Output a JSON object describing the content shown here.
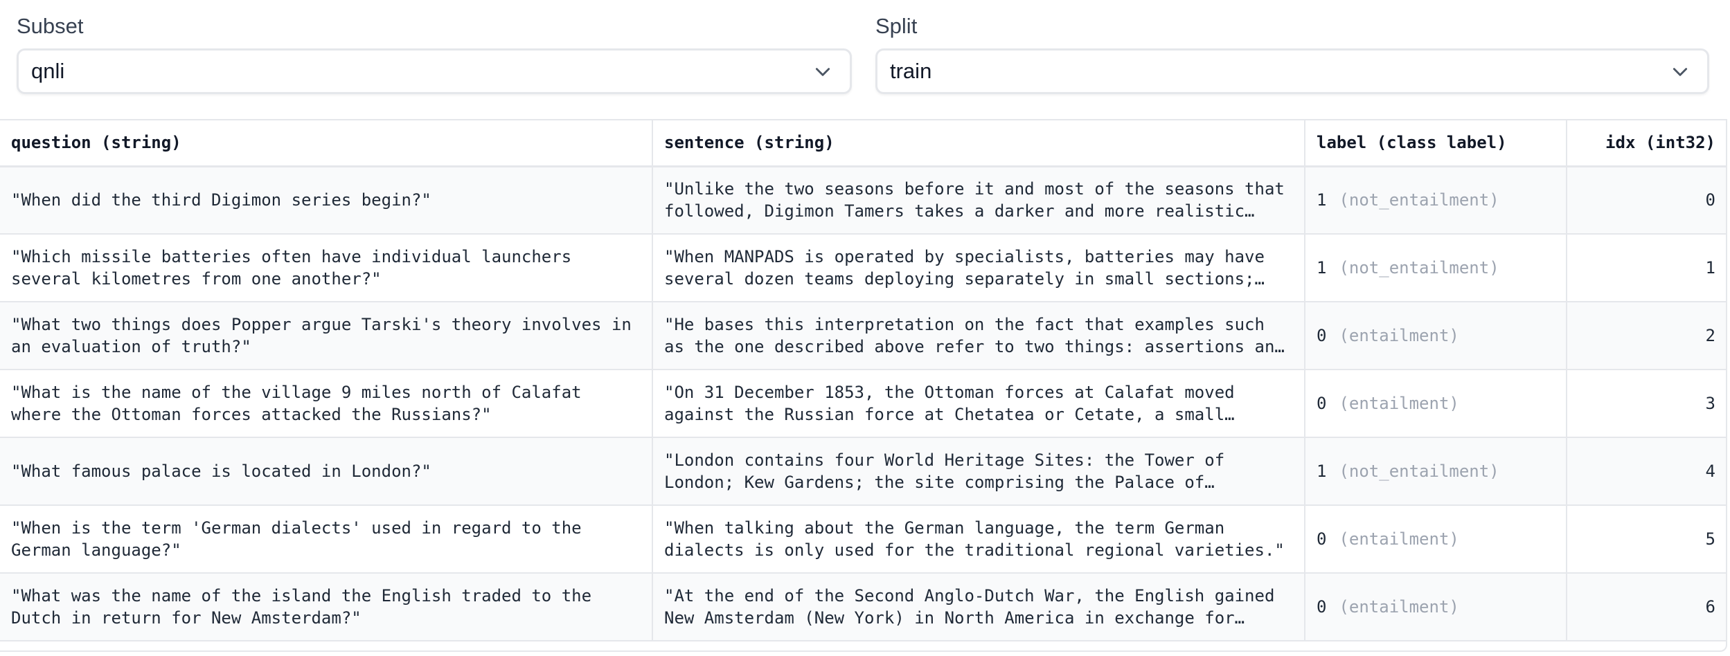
{
  "selectors": {
    "subset": {
      "label": "Subset",
      "value": "qnli"
    },
    "split": {
      "label": "Split",
      "value": "train"
    }
  },
  "table": {
    "columns": [
      "question (string)",
      "sentence (string)",
      "label (class label)",
      "idx (int32)"
    ],
    "rows": [
      {
        "question": "\"When did the third Digimon series begin?\"",
        "sentence": "\"Unlike the two seasons before it and most of the seasons that followed, Digimon Tamers takes a darker and more realistic…",
        "label_num": "1",
        "label_name": "(not_entailment)",
        "idx": "0"
      },
      {
        "question": "\"Which missile batteries often have individual launchers several kilometres from one another?\"",
        "sentence": "\"When MANPADS is operated by specialists, batteries may have several dozen teams deploying separately in small sections;…",
        "label_num": "1",
        "label_name": "(not_entailment)",
        "idx": "1"
      },
      {
        "question": "\"What two things does Popper argue Tarski's theory involves in an evaluation of truth?\"",
        "sentence": "\"He bases this interpretation on the fact that examples such as the one described above refer to two things: assertions an…",
        "label_num": "0",
        "label_name": "(entailment)",
        "idx": "2"
      },
      {
        "question": "\"What is the name of the village 9 miles north of Calafat where the Ottoman forces attacked the Russians?\"",
        "sentence": "\"On 31 December 1853, the Ottoman forces at Calafat moved against the Russian force at Chetatea or Cetate, a small…",
        "label_num": "0",
        "label_name": "(entailment)",
        "idx": "3"
      },
      {
        "question": "\"What famous palace is located in London?\"",
        "sentence": "\"London contains four World Heritage Sites: the Tower of London; Kew Gardens; the site comprising the Palace of…",
        "label_num": "1",
        "label_name": "(not_entailment)",
        "idx": "4"
      },
      {
        "question": "\"When is the term 'German dialects' used in regard to the German language?\"",
        "sentence": "\"When talking about the German language, the term German dialects is only used for the traditional regional varieties.\"",
        "label_num": "0",
        "label_name": "(entailment)",
        "idx": "5"
      },
      {
        "question": "\"What was the name of the island the English traded to the Dutch in return for New Amsterdam?\"",
        "sentence": "\"At the end of the Second Anglo-Dutch War, the English gained New Amsterdam (New York) in North America in exchange for…",
        "label_num": "0",
        "label_name": "(entailment)",
        "idx": "6"
      }
    ]
  }
}
